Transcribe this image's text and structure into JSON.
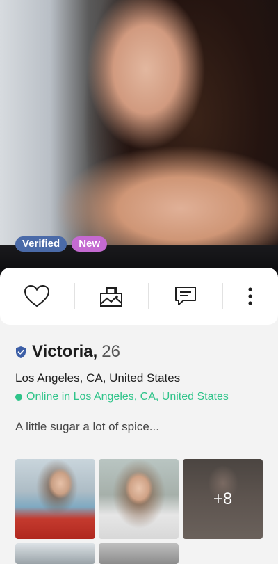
{
  "profile": {
    "badges": {
      "verified": "Verified",
      "new": "New"
    },
    "name": "Victoria,",
    "age": "26",
    "location": "Los Angeles, CA, United States",
    "online_status": "Online in Los Angeles, CA, United States",
    "bio": "A little sugar a lot of spice..."
  },
  "actions": [
    {
      "icon": "heart-icon"
    },
    {
      "icon": "photo-request-icon"
    },
    {
      "icon": "chat-icon"
    },
    {
      "icon": "more-vertical-icon"
    }
  ],
  "gallery": {
    "more_count": "+8"
  },
  "colors": {
    "verified_badge": "#4a6aa8",
    "new_badge": "#c46ad1",
    "online": "#2fc48a",
    "shield": "#3c5ea6"
  }
}
